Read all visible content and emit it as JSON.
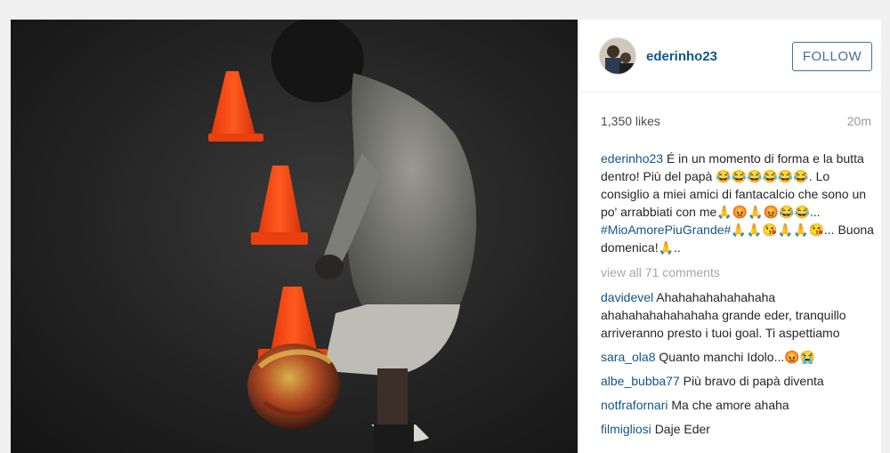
{
  "post": {
    "username": "ederinho23",
    "follow_label": "FOLLOW",
    "likes": "1,350 likes",
    "time": "20m",
    "caption_user": "ederinho23",
    "caption_text_1": "É in un momento di forma e la butta dentro! Più del papà 😂😂😂😂😂😂. Lo consiglio a miei amici di fantacalcio che sono un po' arrabbiati con me🙏😡🙏😡😂😂...",
    "caption_hashtag": "#MioAmorePiuGrande#🙏🙏😘🙏🙏😘",
    "caption_text_2": "... Buona domenica!🙏..",
    "view_all": "view all 71 comments"
  },
  "comments": [
    {
      "user": "davidevel",
      "text": "Ahahahahahahahaha ahahahahahahahaha grande eder, tranquillo arriveranno presto i tuoi goal. Ti aspettiamo"
    },
    {
      "user": "sara_ola8",
      "text": "Quanto manchi Idolo...😡😭"
    },
    {
      "user": "albe_bubba77",
      "text": "Più bravo di papà diventa"
    },
    {
      "user": "notfrafornari",
      "text": "Ma che amore ahaha"
    },
    {
      "user": "filmigliosi",
      "text": "Daje Eder"
    }
  ],
  "colors": {
    "link": "#125688",
    "follow_border": "#3f729b",
    "cone": "#ff4a12"
  },
  "icons": {
    "avatar": "profile-photo"
  }
}
